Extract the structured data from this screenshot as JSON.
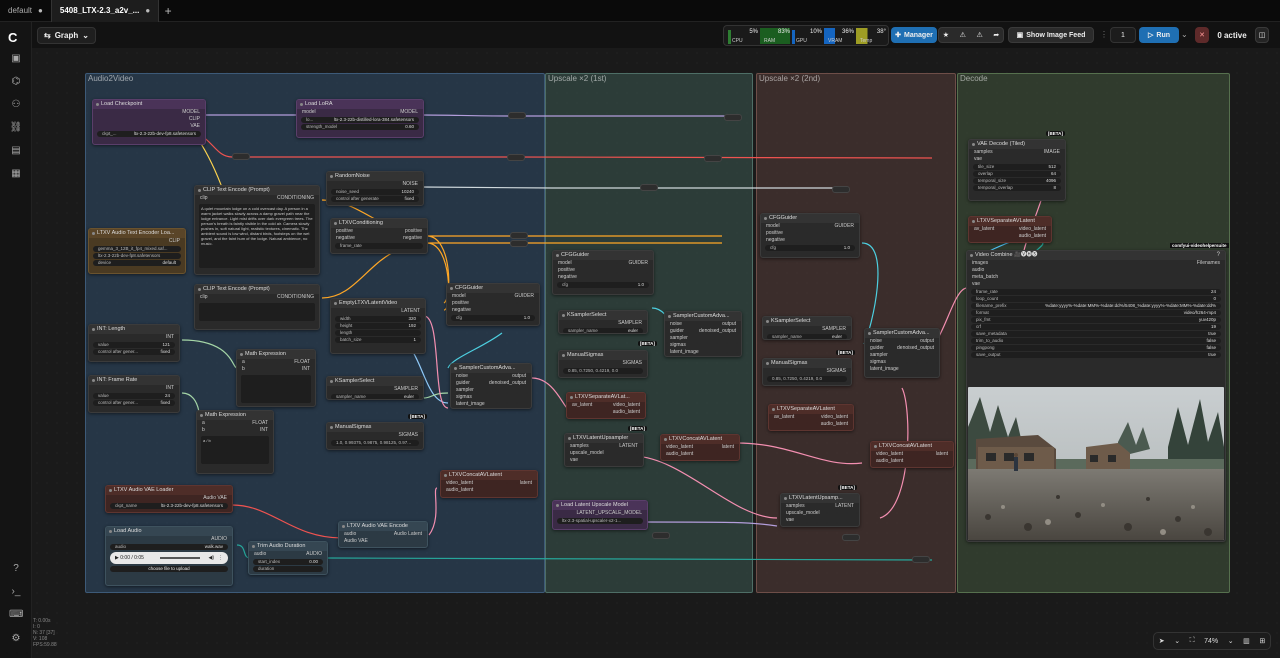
{
  "tabs": [
    {
      "label": "default",
      "active": false
    },
    {
      "label": "5408_LTX-2.3_a2v_...",
      "active": true
    }
  ],
  "toolbar": {
    "graph_label": "Graph",
    "monitor": [
      {
        "label": "CPU",
        "value": "5%",
        "color": "#2e7d32"
      },
      {
        "label": "RAM",
        "value": "83%",
        "color": "#2e7d32"
      },
      {
        "label": "GPU",
        "value": "10%",
        "color": "#1565c0"
      },
      {
        "label": "VRAM",
        "value": "36%",
        "color": "#1565c0"
      },
      {
        "label": "Temp",
        "value": "38°",
        "color": "#9e9d24"
      }
    ],
    "manager_label": "Manager",
    "feed_label": "Show Image Feed",
    "run_count": "1",
    "run_label": "Run",
    "active_label": "0 active"
  },
  "groups": [
    {
      "title": "Audio2Video",
      "color": "#2b3f55"
    },
    {
      "title": "Upscale ×2 (1st)",
      "color": "#334a44"
    },
    {
      "title": "Upscale ×2 (2nd)",
      "color": "#4a3835"
    },
    {
      "title": "Decode",
      "color": "#3a4a36"
    }
  ],
  "nodes": {
    "load_checkpoint": {
      "title": "Load Checkpoint",
      "out1": "MODEL",
      "out2": "CLIP",
      "out3": "VAE",
      "w_name": "ckpt_...",
      "w_val": "ltx-2.3-22b-dev-fp8.safetensors"
    },
    "load_lora": {
      "title": "Load LoRA",
      "in1": "model",
      "out1": "MODEL",
      "w1_name": "lo...",
      "w1_val": "ltx-2.3-22b-distilled-lora-384.safetensors",
      "w2_name": "strength_model",
      "w2_val": "0.60"
    },
    "clip_pos": {
      "title": "CLIP Text Encode (Prompt)",
      "in1": "clip",
      "out1": "CONDITIONING",
      "text": "A quiet mountain lodge on a cold overcast day. A person in a warm jacket walks slowly across a damp gravel path near the lodge entrance. Light mist drifts over dark evergreen trees. The person's breath is faintly visible in the cold air. Camera slowly pushes in, soft natural light, realistic textures, cinematic. The ambient sound is low wind, distant birds, footsteps on the wet gravel, and the faint hum of the lodge. Natural ambience, no music."
    },
    "clip_neg": {
      "title": "CLIP Text Encode (Prompt)",
      "in1": "clip",
      "out1": "CONDITIONING"
    },
    "ltxv_audio_text": {
      "title": "LTXV Audio Text Encoder Loa...",
      "out1": "CLIP",
      "w1_val": "gemma_3_12B_it_fp4_mixed.saf...",
      "w2_val": "ltx-2.3-22b-dev-fp8.safetensors",
      "w3_name": "device",
      "w3_val": "default"
    },
    "random_noise": {
      "title": "RandomNoise",
      "out1": "NOISE",
      "w1_name": "noise_seed",
      "w1_val": "10240",
      "w2_name": "control after generate",
      "w2_val": "fixed"
    },
    "ltxv_cond": {
      "title": "LTXVConditioning",
      "in1": "positive",
      "in2": "negative",
      "out1": "positive",
      "out2": "negative",
      "w_name": "frame_rate"
    },
    "cfg_main": {
      "title": "CFGGuider",
      "in1": "model",
      "in2": "positive",
      "in3": "negative",
      "out1": "GUIDER",
      "w_name": "cfg",
      "w_val": "1.0"
    },
    "empty_latent": {
      "title": "EmptyLTXVLatentVideo",
      "out1": "LATENT",
      "w1_name": "width",
      "w1_val": "320",
      "w2_name": "height",
      "w2_val": "192",
      "w3_name": "length",
      "w4_name": "batch_size",
      "w4_val": "1"
    },
    "int_length": {
      "title": "INT: Length",
      "out1": "INT",
      "w1_name": "value",
      "w1_val": "121",
      "w2_name": "control after gener...",
      "w2_val": "fixed"
    },
    "int_fps": {
      "title": "INT: Frame Rate",
      "out1": "INT",
      "w1_name": "value",
      "w1_val": "24",
      "w2_name": "control after gener...",
      "w2_val": "fixed"
    },
    "math1": {
      "title": "Math Expression",
      "in1": "a",
      "in2": "b",
      "out1": "FLOAT",
      "out2": "INT"
    },
    "math2": {
      "title": "Math Expression",
      "in1": "a",
      "in2": "b",
      "out1": "FLOAT",
      "out2": "INT",
      "text": "a / b"
    },
    "ksampler_sel": {
      "title": "KSamplerSelect",
      "out1": "SAMPLER",
      "w_name": "sampler_name",
      "w_val": "euler"
    },
    "manual_sigmas": {
      "title": "ManualSigmas",
      "out1": "SIGMAS",
      "w_val": "1.0, 0.99375, 0.9875, 0.98125, 0.97..."
    },
    "sampler_custom": {
      "title": "SamplerCustomAdva...",
      "in1": "noise",
      "in2": "guider",
      "in3": "sampler",
      "in4": "sigmas",
      "in5": "latent_image",
      "out1": "output",
      "out2": "denoised_output"
    },
    "ltxv_concat": {
      "title": "LTXVConcatAVLatent",
      "in1": "video_latent",
      "in2": "audio_latent",
      "out1": "latent"
    },
    "audio_vae_loader": {
      "title": "LTXV Audio VAE Loader",
      "out1": "Audio VAE",
      "w_name": "ckpt_name",
      "w_val": "ltx-2.3-22b-dev-fp8.safetensors"
    },
    "load_audio": {
      "title": "Load Audio",
      "out1": "AUDIO",
      "w_name": "audio",
      "w_val": "walk.wav",
      "player": "0:00 / 0:05",
      "upload_label": "choose file to upload"
    },
    "trim_audio": {
      "title": "Trim Audio Duration",
      "in1": "audio",
      "out1": "AUDIO",
      "w1_name": "start_index",
      "w1_val": "0.00",
      "w2_name": "duration"
    },
    "audio_vae_encode": {
      "title": "LTXV Audio VAE Encode",
      "in1": "audio",
      "in2": "Audio VAE",
      "out1": "Audio Latent"
    },
    "cfg_1st": {
      "title": "CFGGuider",
      "in1": "model",
      "in2": "positive",
      "in3": "negative",
      "out1": "GUIDER",
      "w_name": "cfg",
      "w_val": "1.0"
    },
    "ksampler_sel_1st": {
      "title": "KSamplerSelect",
      "out1": "SAMPLER",
      "w_name": "sampler_name",
      "w_val": "euler"
    },
    "manual_sigmas_1st": {
      "title": "ManualSigmas",
      "out1": "SIGMAS",
      "w_val": "0.85, 0.7250, 0.4219, 0.0"
    },
    "sampler_custom_1st": {
      "title": "SamplerCustomAdva...",
      "in1": "noise",
      "in2": "guider",
      "in3": "sampler",
      "in4": "sigmas",
      "in5": "latent_image",
      "out1": "output",
      "out2": "denoised_output"
    },
    "separate_1st": {
      "title": "LTXVSeparateAVLat...",
      "in1": "av_latent",
      "out1": "video_latent",
      "out2": "audio_latent"
    },
    "upsampler_1st": {
      "title": "LTXVLatentUpsampler",
      "in1": "samples",
      "in2": "upscale_model",
      "in3": "vae",
      "out1": "LATENT"
    },
    "concat_1st": {
      "title": "LTXVConcatAVLatent",
      "in1": "video_latent",
      "in2": "audio_latent",
      "out1": "latent"
    },
    "upscale_loader": {
      "title": "Load Latent Upscale Model",
      "out1": "LATENT_UPSCALE_MODEL",
      "w_val": "ltx-2.3-spatial-upscaler-x2-1..."
    },
    "cfg_2nd": {
      "title": "CFGGuider",
      "in1": "model",
      "in2": "positive",
      "in3": "negative",
      "out1": "GUIDER",
      "w_name": "cfg",
      "w_val": "1.0"
    },
    "ksampler_sel_2nd": {
      "title": "KSamplerSelect",
      "out1": "SAMPLER",
      "w_name": "sampler_name",
      "w_val": "euler"
    },
    "manual_sigmas_2nd": {
      "title": "ManualSigmas",
      "out1": "SIGMAS",
      "w_val": "0.85, 0.7250, 0.4219, 0.0"
    },
    "sampler_custom_2nd": {
      "title": "SamplerCustomAdva...",
      "in1": "noise",
      "in2": "guider",
      "in3": "sampler",
      "in4": "sigmas",
      "in5": "latent_image",
      "out1": "output",
      "out2": "denoised_output"
    },
    "separate_2nd": {
      "title": "LTXVSeparateAVLatent",
      "in1": "av_latent",
      "out1": "video_latent",
      "out2": "audio_latent"
    },
    "upsampler_2nd": {
      "title": "LTXVLatentUpsamp...",
      "in1": "samples",
      "in2": "upscale_model",
      "in3": "vae",
      "out1": "LATENT"
    },
    "concat_2nd": {
      "title": "LTXVConcatAVLatent",
      "in1": "video_latent",
      "in2": "audio_latent",
      "out1": "latent"
    },
    "vae_decode": {
      "title": "VAE Decode (Tiled)",
      "in1": "samples",
      "in2": "vae",
      "out1": "IMAGE",
      "w1_name": "tile_size",
      "w1_val": "512",
      "w2_name": "overlap",
      "w2_val": "64",
      "w3_name": "temporal_size",
      "w3_val": "4096",
      "w4_name": "temporal_overlap",
      "w4_val": "8"
    },
    "separate_decode": {
      "title": "LTXVSeparateAVLatent",
      "in1": "av_latent",
      "out1": "video_latent",
      "out2": "audio_latent"
    },
    "video_combine": {
      "title": "Video Combine 🎥🅥🅗🅢",
      "badge": "comfyui-videohelpersuite",
      "in1": "images",
      "in2": "audio",
      "in3": "meta_batch",
      "in4": "vae",
      "out1": "Filenames",
      "widgets": [
        {
          "name": "frame_rate",
          "value": "24"
        },
        {
          "name": "loop_count",
          "value": "0"
        },
        {
          "name": "filename_prefix",
          "value": "%date:yyyy%-%date:MM%-%date:dd%/5408_%date:yyyy%-%date:MM%-%date:dd%"
        },
        {
          "name": "format",
          "value": "video/h264-mp4"
        },
        {
          "name": "pix_fmt",
          "value": "yuv420p"
        },
        {
          "name": "crf",
          "value": "19"
        },
        {
          "name": "save_metadata",
          "value": "true"
        },
        {
          "name": "trim_to_audio",
          "value": "false"
        },
        {
          "name": "pingpong",
          "value": "false"
        },
        {
          "name": "save_output",
          "value": "true"
        }
      ]
    }
  },
  "beta_label": "[BETA]",
  "stats": [
    "T: 0.00s",
    "I: 0",
    "N: 37 [37]",
    "V: 108",
    "FPS:59.88"
  ],
  "zoom": "74%"
}
